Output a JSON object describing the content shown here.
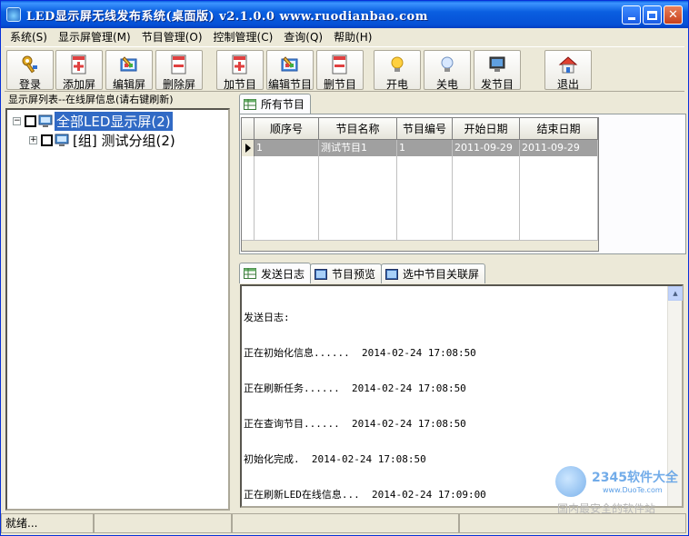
{
  "window": {
    "title": "LED显示屏无线发布系统(桌面版) v2.1.0.0 www.ruodianbao.com",
    "minimize": "_",
    "maximize": "□",
    "close": "✕"
  },
  "menu": [
    "系统(S)",
    "显示屏管理(M)",
    "节目管理(O)",
    "控制管理(C)",
    "查询(Q)",
    "帮助(H)"
  ],
  "toolbar": {
    "buttons": [
      {
        "label": "登录",
        "icon": "key-login-icon"
      },
      {
        "label": "添加屏",
        "icon": "add-screen-icon"
      },
      {
        "label": "编辑屏",
        "icon": "edit-screen-icon"
      },
      {
        "label": "删除屏",
        "icon": "delete-screen-icon"
      },
      {
        "label": "加节目",
        "icon": "add-program-icon"
      },
      {
        "label": "编辑节目",
        "icon": "edit-program-icon"
      },
      {
        "label": "删节目",
        "icon": "delete-program-icon"
      },
      {
        "label": "开电",
        "icon": "power-on-bulb-icon"
      },
      {
        "label": "关电",
        "icon": "power-off-bulb-icon"
      },
      {
        "label": "发节目",
        "icon": "send-program-icon"
      },
      {
        "label": "退出",
        "icon": "exit-house-icon"
      }
    ]
  },
  "left_panel": {
    "caption": "显示屏列表--在线屏信息(请右键刷新)",
    "tree": [
      {
        "expander": "−",
        "label": "全部LED显示屏(2)",
        "selected": true
      },
      {
        "expander": "+",
        "label": "[组] 测试分组(2)",
        "selected": false
      }
    ]
  },
  "programs_tab": {
    "label": "所有节目",
    "columns": [
      "顺序号",
      "节目名称",
      "节目编号",
      "开始日期",
      "结束日期"
    ],
    "rows": [
      [
        "1",
        "测试节目1",
        "1",
        "2011-09-29",
        "2011-09-29"
      ]
    ]
  },
  "bottom_tabs": [
    "发送日志",
    "节目预览",
    "选中节目关联屏"
  ],
  "log": {
    "lines": [
      "发送日志:",
      "正在初始化信息......  2014-02-24 17:08:50",
      "正在刷新任务......  2014-02-24 17:08:50",
      "正在查询节目......  2014-02-24 17:08:50",
      "初始化完成.  2014-02-24 17:08:50",
      "正在刷新LED在线信息...  2014-02-24 17:09:00"
    ]
  },
  "status": {
    "text": "就绪..."
  },
  "watermark": {
    "title": "2345软件大全",
    "url": "www.DuoTe.com",
    "slogan": "国内最安全的软件站"
  },
  "colors": {
    "title_bar": "#0a5fe0",
    "window_bg": "#ece9d8",
    "selection": "#316ac5",
    "grid_selected_row": "#a0a0a0"
  }
}
